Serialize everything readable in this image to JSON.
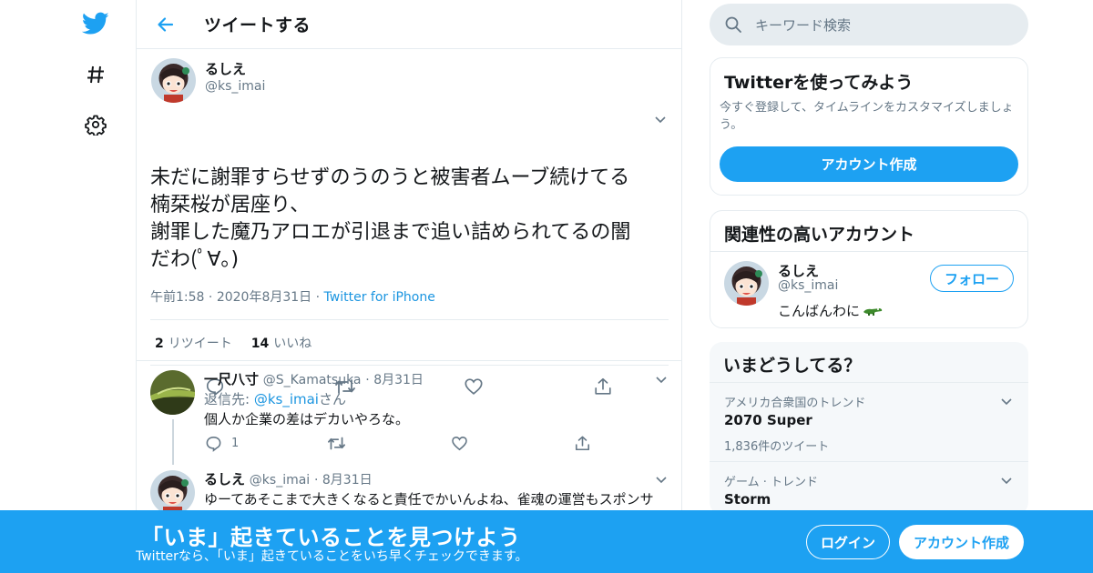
{
  "colors": {
    "accent": "#1da1f2",
    "link": "#1b95e0",
    "gray": "#657786",
    "border": "#e6ecf0"
  },
  "nav": {
    "icons": [
      "twitter-bird-icon",
      "hashtag-icon",
      "gear-icon"
    ]
  },
  "header": {
    "title": "ツイートする"
  },
  "tweet": {
    "name": "るしえ",
    "handle": "@ks_imai",
    "text_lines": [
      "未だに謝罪すらせずのうのうと被害者ムーブ続けてる",
      "楠栞桜が居座り、",
      "謝罪した魔乃アロエが引退まで追い詰められてるの闇",
      "だわ(ﾟ∀｡)"
    ],
    "time": "午前1:58",
    "date": "2020年8月31日",
    "source": "Twitter for iPhone",
    "retweet_count": "2",
    "retweet_label": "リツイート",
    "like_count": "14",
    "like_label": "いいね"
  },
  "replies": [
    {
      "name": "一尺八寸",
      "handle": "@S_Kamatsuka",
      "date": "8月31日",
      "reply_to_prefix": "返信先: ",
      "reply_to_handle": "@ks_imai",
      "reply_to_suffix": "さん",
      "text": "個人か企業の差はデカいやろな。",
      "reply_count": "1"
    },
    {
      "name": "るしえ",
      "handle": "@ks_imai",
      "date": "8月31日",
      "text": "ゆーてあそこまで大きくなると責任でかいんよね、雀魂の運営もスポンサ"
    }
  ],
  "search": {
    "placeholder": "キーワード検索"
  },
  "signup_card": {
    "title": "Twitterを使ってみよう",
    "desc_line1": "今すぐ登録して、タイムラインをカスタマイズしましょ",
    "desc_line2": "う。",
    "button": "アカウント作成"
  },
  "related": {
    "title": "関連性の高いアカウント",
    "name": "るしえ",
    "handle": "@ks_imai",
    "bio": "こんばんわに",
    "follow": "フォロー"
  },
  "trends": {
    "title": "いまどうしてる？",
    "items": [
      {
        "label": "アメリカ合衆国のトレンド",
        "name": "2070 Super",
        "count": "1,836件のツイート"
      },
      {
        "label": "ゲーム · トレンド",
        "name": "Storm",
        "count": ""
      }
    ]
  },
  "bottom": {
    "title": "「いま」起きていることを見つけよう",
    "subtitle": "Twitterなら、「いま」起きていることをいち早くチェックできます。",
    "login": "ログイン",
    "signup": "アカウント作成"
  }
}
